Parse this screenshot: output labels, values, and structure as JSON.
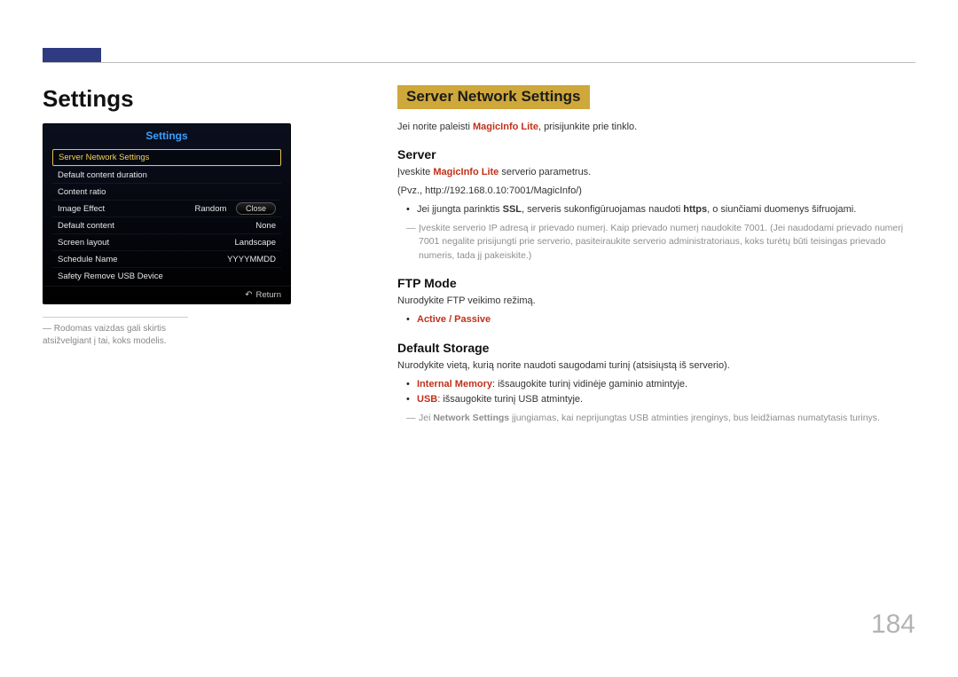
{
  "page_number": "184",
  "left": {
    "title": "Settings",
    "osd": {
      "title": "Settings",
      "rows": [
        {
          "label": "Server Network Settings",
          "value": "",
          "selected": true
        },
        {
          "label": "Default content duration",
          "value": ""
        },
        {
          "label": "Content ratio",
          "value": ""
        },
        {
          "label": "Image Effect",
          "value": "Random"
        },
        {
          "label": "Default content",
          "value": "None"
        },
        {
          "label": "Screen layout",
          "value": "Landscape"
        },
        {
          "label": "Schedule Name",
          "value": "YYYYMMDD"
        },
        {
          "label": "Safety Remove USB Device",
          "value": ""
        }
      ],
      "close_label": "Close",
      "return_label": "Return"
    },
    "note": "Rodomas vaizdas gali skirtis atsižvelgiant į tai, koks modelis."
  },
  "right": {
    "heading": "Server Network Settings",
    "intro_prefix": "Jei norite paleisti ",
    "intro_red": "MagicInfo Lite",
    "intro_suffix": ", prisijunkite prie tinklo.",
    "server": {
      "title": "Server",
      "l1_prefix": "Įveskite ",
      "l1_red": "MagicInfo Lite",
      "l1_suffix": " serverio parametrus.",
      "l2": "(Pvz., http://192.168.0.10:7001/MagicInfo/)",
      "bullet_prefix": "Jei įjungta parinktis ",
      "bullet_bold1": "SSL",
      "bullet_mid": ", serveris sukonfigūruojamas naudoti ",
      "bullet_bold2": "https",
      "bullet_suffix": ", o siunčiami duomenys šifruojami.",
      "footnote": "Įveskite serverio IP adresą ir prievado numerį. Kaip prievado numerį naudokite 7001. (Jei naudodami prievado numerį 7001 negalite prisijungti prie serverio, pasiteiraukite serverio administratoriaus, koks turėtų būti teisingas prievado numeris, tada jį pakeiskite.)"
    },
    "ftp": {
      "title": "FTP Mode",
      "l1": "Nurodykite FTP veikimo režimą.",
      "bullet": "Active / Passive"
    },
    "storage": {
      "title": "Default Storage",
      "l1": "Nurodykite vietą, kurią norite naudoti saugodami turinį (atsisiųstą iš serverio).",
      "b1_red": "Internal Memory",
      "b1_suffix": ": išsaugokite turinį vidinėje gaminio atmintyje.",
      "b2_red": "USB",
      "b2_suffix": ": išsaugokite turinį USB atmintyje.",
      "foot_prefix": "Jei ",
      "foot_bold": "Network Settings",
      "foot_suffix": " įjungiamas, kai neprijungtas USB atminties įrenginys, bus leidžiamas numatytasis turinys."
    }
  }
}
